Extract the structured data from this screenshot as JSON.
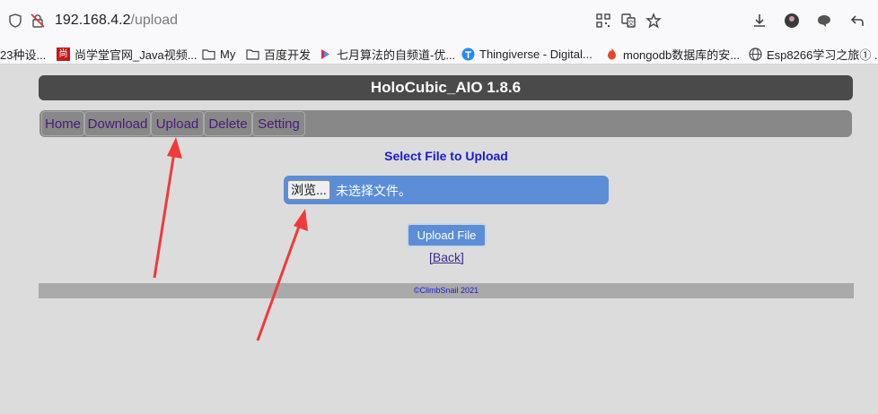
{
  "browser": {
    "url_host": "192.168.4.2",
    "url_path": "/upload",
    "bookmarks": [
      {
        "label": "23种设...",
        "icon": "generic-favicon-icon"
      },
      {
        "label": "尚学堂官网_Java视频...",
        "icon": "shangxuetang-favicon-icon"
      },
      {
        "label": "My",
        "icon": "folder-icon"
      },
      {
        "label": "百度开发",
        "icon": "folder-icon"
      },
      {
        "label": "七月算法的自频道-优...",
        "icon": "youku-favicon-icon"
      },
      {
        "label": "Thingiverse - Digital...",
        "icon": "thingiverse-favicon-icon"
      },
      {
        "label": "mongodb数据库的安...",
        "icon": "csdn-favicon-icon"
      },
      {
        "label": "Esp8266学习之旅① ...",
        "icon": "globe-icon"
      }
    ]
  },
  "page": {
    "header_title": "HoloCubic_AIO 1.8.6",
    "nav": [
      {
        "label": "Home"
      },
      {
        "label": "Download"
      },
      {
        "label": "Upload"
      },
      {
        "label": "Delete"
      },
      {
        "label": "Setting"
      }
    ],
    "select_title": "Select File to Upload",
    "browse_label": "浏览...",
    "file_status": "未选择文件。",
    "upload_button": "Upload File",
    "back_link": "[Back]",
    "footer": "©ClimbSnail 2021"
  },
  "colors": {
    "header_bg": "#4a4a4a",
    "nav_bg": "#888888",
    "accent_blue": "#5b8ed6",
    "annotation_arrow": "#f03a3a"
  }
}
